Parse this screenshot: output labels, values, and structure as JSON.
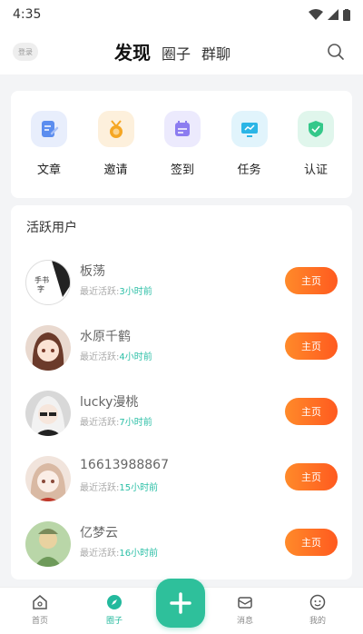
{
  "status_bar": {
    "time": "4:35"
  },
  "header": {
    "login_label": "登录",
    "tabs": [
      {
        "label": "发现",
        "active": true
      },
      {
        "label": "圈子",
        "active": false
      },
      {
        "label": "群聊",
        "active": false
      }
    ],
    "search_icon": "search-icon"
  },
  "quick_actions": [
    {
      "label": "文章",
      "icon": "article-icon",
      "color": "#5b8def"
    },
    {
      "label": "邀请",
      "icon": "invite-icon",
      "color": "#f5a623"
    },
    {
      "label": "签到",
      "icon": "checkin-icon",
      "color": "#8c7cf0"
    },
    {
      "label": "任务",
      "icon": "task-icon",
      "color": "#2bb5e6"
    },
    {
      "label": "认证",
      "icon": "verify-icon",
      "color": "#34c88a"
    }
  ],
  "active_users": {
    "title": "活跃用户",
    "active_prefix": "最近活跃:",
    "button_label": "主页",
    "users": [
      {
        "name": "板荡",
        "last_active": "3小时前"
      },
      {
        "name": "水原千鹤",
        "last_active": "4小时前"
      },
      {
        "name": "lucky漫桃",
        "last_active": "7小时前"
      },
      {
        "name": "16613988867",
        "last_active": "15小时前"
      },
      {
        "name": "亿梦云",
        "last_active": "16小时前"
      }
    ]
  },
  "bottom_nav": {
    "items": [
      {
        "label": "首页",
        "icon": "home-icon",
        "active": false
      },
      {
        "label": "圈子",
        "icon": "compass-icon",
        "active": true
      },
      {
        "label": "消息",
        "icon": "message-icon",
        "active": false
      },
      {
        "label": "我的",
        "icon": "profile-icon",
        "active": false
      }
    ]
  },
  "colors": {
    "accent": "#2ec09b",
    "button_gradient_start": "#ff8a2a",
    "button_gradient_end": "#ff5a1f",
    "active_time": "#2bbfa6"
  }
}
